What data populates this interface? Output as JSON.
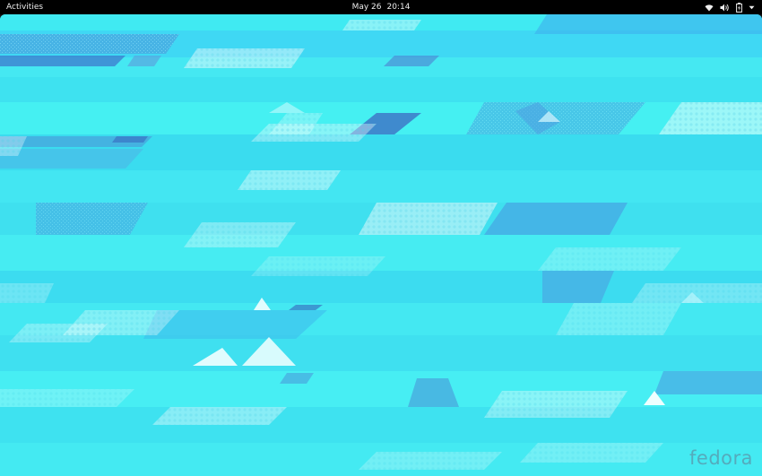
{
  "topbar": {
    "activities_label": "Activities",
    "date": "May 26",
    "time": "20:14",
    "status_icons": [
      "wifi-icon",
      "volume-icon",
      "battery-icon",
      "chevron-down-icon"
    ]
  },
  "desktop": {
    "wallpaper_base_color": "#3ee8f0",
    "logo_text": "fedora"
  },
  "colors": {
    "topbar_bg": "#000000",
    "topbar_text": "#eeeeee",
    "accent_light": "#bff7fa",
    "accent_dark": "#4d8fd6"
  }
}
